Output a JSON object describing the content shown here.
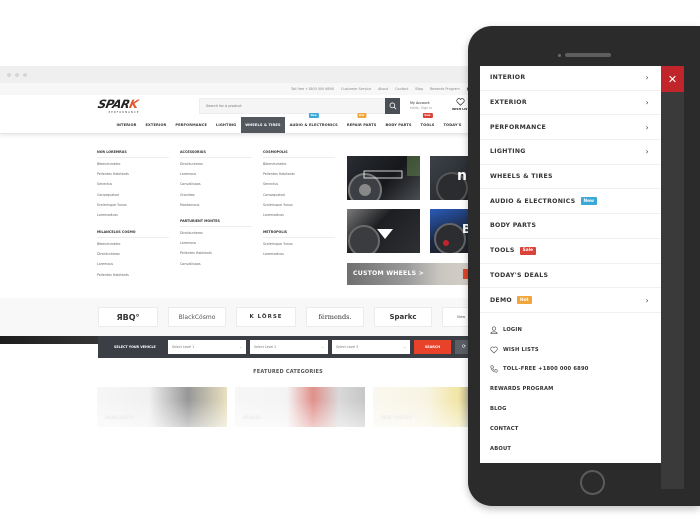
{
  "browser": {
    "topbar_links": [
      "Toll free +1800 000 6890",
      "Customer Service",
      "About",
      "Contact",
      "Blog",
      "Rewards Program",
      "En"
    ],
    "logo": {
      "word_main": "SPAR",
      "word_accent": "K",
      "sub": "PERFORMANCE"
    },
    "search": {
      "placeholder": "Search for a product",
      "icon": "search-icon"
    },
    "account": {
      "title": "My Account",
      "subtitle": "Hello, Sign in"
    },
    "wishlist": {
      "label": "WISH LIST",
      "icon": "heart-icon"
    },
    "nav": [
      {
        "label": "INTERIOR"
      },
      {
        "label": "EXTERIOR"
      },
      {
        "label": "PERFORMANCE"
      },
      {
        "label": "LIGHTING"
      },
      {
        "label": "WHEELS & TIRES",
        "active": true
      },
      {
        "label": "AUDIO & ELECTRONICS",
        "badge": "New",
        "badge_color": "#3aa8d8"
      },
      {
        "label": "REPAIR PARTS",
        "badge": "Hot",
        "badge_color": "#f0a63a"
      },
      {
        "label": "BODY PARTS"
      },
      {
        "label": "TOOLS",
        "badge": "Sale",
        "badge_color": "#d9433a"
      },
      {
        "label": "TODAY'S"
      }
    ],
    "mega_menu": {
      "columns": [
        {
          "heading": "NOR LOREMRUS",
          "links": [
            "Bibendumetro",
            "Pellentes Habitants",
            "Senectus",
            "Consequatod",
            "Scelerisque Yunus",
            "Loremodicas"
          ]
        },
        {
          "heading": "MILANCELOS COSMO",
          "links": [
            "Bibendumetro",
            "Dincidunteros",
            "Loremous",
            "Pellentes Habitants"
          ]
        },
        {
          "heading": "ACCESSORIUS",
          "links": [
            "Dincidunteros",
            "Loremous",
            "Convallisaos",
            "Gravidas",
            "Montomous"
          ]
        },
        {
          "heading": "PARTURIENT MONTES",
          "links": [
            "Dincidunteros",
            "Loremous",
            "Pellentes Habitants",
            "Convallisaos"
          ]
        },
        {
          "heading": "COSMOPOLIS",
          "links": [
            "Bibendumetro",
            "Pellentes Habitants",
            "Senectus",
            "Consequatod",
            "Scelerisque Yunus",
            "Loremodicas"
          ]
        },
        {
          "heading": "METROPOLIS",
          "links": [
            "Scelerisque Yunus",
            "Loremodicas"
          ]
        }
      ],
      "promo_banner": "CUSTOM WHEELS >"
    },
    "brands": [
      "ЯBQ°",
      "BlackCósmo",
      "K LÖRSE",
      "férmends.",
      "Sparkc",
      "View"
    ],
    "vehicle_selector": {
      "label": "SELECT YOUR VEHICLE",
      "selects": [
        "Select Level 1",
        "Select Level 2",
        "Select Level 3"
      ],
      "search_label": "SEARCH"
    },
    "featured": {
      "title": "FEATURED CATEGORIES",
      "categories": [
        "HEADLIGHTS",
        "BRAKES",
        "SEAT COVERS"
      ]
    }
  },
  "mobile_menu": {
    "close_icon": "close-icon",
    "items": [
      {
        "label": "INTERIOR",
        "has_submenu": true
      },
      {
        "label": "EXTERIOR",
        "has_submenu": true
      },
      {
        "label": "PERFORMANCE",
        "has_submenu": true
      },
      {
        "label": "LIGHTING",
        "has_submenu": true
      },
      {
        "label": "WHEELS & TIRES",
        "has_submenu": false
      },
      {
        "label": "AUDIO & ELECTRONICS",
        "badge": "New",
        "badge_color": "#3aa8d8",
        "has_submenu": false
      },
      {
        "label": "BODY PARTS",
        "has_submenu": false
      },
      {
        "label": "TOOLS",
        "badge": "Sale",
        "badge_color": "#d9433a",
        "has_submenu": false
      },
      {
        "label": "TODAY'S DEALS",
        "has_submenu": false
      },
      {
        "label": "DEMO",
        "badge": "Hot",
        "badge_color": "#f0a63a",
        "has_submenu": true
      }
    ],
    "utility": [
      {
        "label": "LOGIN",
        "icon": "user-icon"
      },
      {
        "label": "WISH LISTS",
        "icon": "heart-icon"
      },
      {
        "label": "TOLL-FREE +1800 000 6890",
        "icon": "phone-icon"
      },
      {
        "label": "REWARDS PROGRAM"
      },
      {
        "label": "BLOG"
      },
      {
        "label": "CONTACT"
      },
      {
        "label": "ABOUT"
      }
    ]
  },
  "colors": {
    "accent_red": "#c0252b",
    "search_orange": "#e8432a",
    "nav_active": "#53585f",
    "phone_body": "#2b2b2b"
  }
}
